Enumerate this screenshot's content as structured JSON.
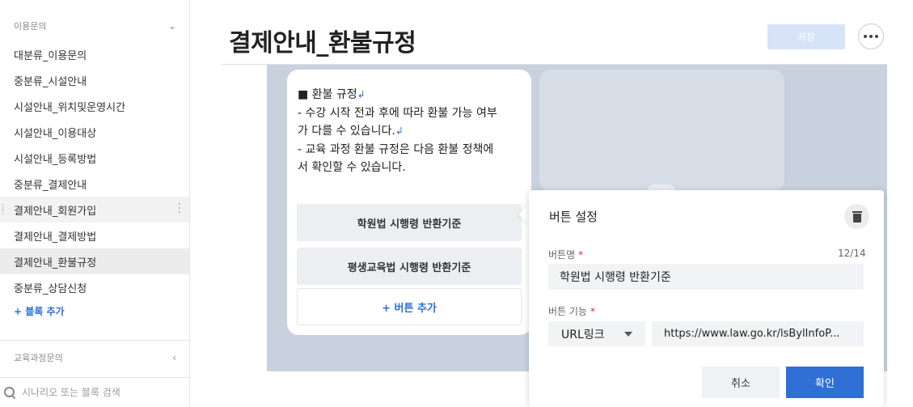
{
  "sidebar": {
    "section1_label": "이용문의",
    "items": [
      {
        "label": "대분류_이용문의"
      },
      {
        "label": "중분류_시설안내"
      },
      {
        "label": "시설안내_위치및운영시간"
      },
      {
        "label": "시설안내_이용대상"
      },
      {
        "label": "시설안내_등록방법"
      },
      {
        "label": "중분류_결제안내"
      },
      {
        "label": "결제안내_회원가입"
      },
      {
        "label": "결제안내_결제방법"
      },
      {
        "label": "결제안내_환불규정"
      },
      {
        "label": "중분류_상담신청"
      }
    ],
    "add_block_label": "+ 블록 추가",
    "section2_label": "교육과정문의",
    "search_placeholder": "시나리오 또는 블록 검색"
  },
  "header": {
    "title": "결제안내_환불규정",
    "save_label": "저장"
  },
  "bubble": {
    "lines": [
      "■ 환불 규정",
      "- 수강 시작 전과 후에 따라 환불 가능 여부",
      "가 다를 수 있습니다.",
      "- 교육 과정 환불 규정은 다음 환불 정책에",
      "서 확인할 수 있습니다."
    ],
    "buttons": [
      {
        "label": "학원법 시행령 반환기준"
      },
      {
        "label": "평생교육법 시행령 반환기준"
      }
    ],
    "add_button_label": "+ 버튼 추가"
  },
  "button_settings": {
    "title": "버튼 설정",
    "name_label": "버튼명",
    "required_mark": "*",
    "counter": "12/14",
    "name_value": "학원법 시행령 반환기준",
    "function_label": "버튼 기능",
    "function_value": "URL링크",
    "url_value": "https://www.law.go.kr/lsBylInfoP...",
    "cancel_label": "취소",
    "confirm_label": "확인"
  },
  "colors": {
    "accent": "#2f6fd6",
    "canvas_bg": "#c8d2de",
    "required": "#d93025"
  }
}
